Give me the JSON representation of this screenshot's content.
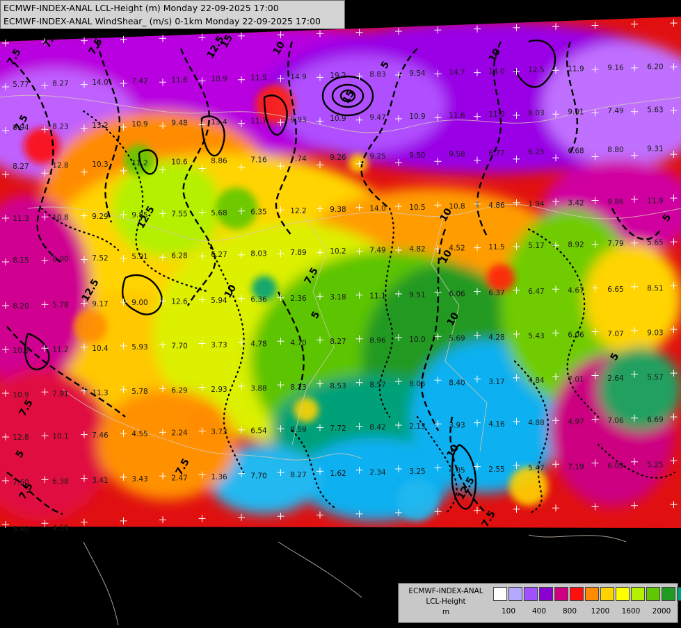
{
  "header": {
    "line1": "ECMWF-INDEX-ANAL LCL-Height (m) Monday 22-09-2025 17:00",
    "line2": "ECMWF-INDEX-ANAL WindShear_ (m/s) 0-1km Monday 22-09-2025 17:00"
  },
  "legend": {
    "model": "ECMWF-INDEX-ANAL",
    "field": "LCL-Height",
    "unit": "m",
    "colors": [
      "#ffffff",
      "#b4a8ff",
      "#a050ff",
      "#8a00d2",
      "#cc0080",
      "#ff1010",
      "#ff8c00",
      "#ffd400",
      "#ffff00",
      "#b4f000",
      "#60c800",
      "#209a20",
      "#00a078",
      "#0aaaf0"
    ],
    "ticks": [
      "100",
      "400",
      "800",
      "1200",
      "1600",
      "2000"
    ]
  },
  "contour_labels": [
    "7.5",
    "10",
    "12.5",
    "15",
    "5"
  ],
  "station_values": [
    "5.77",
    "8.27",
    "14.0",
    "7.42",
    "11.6",
    "10.9",
    "11.5",
    "14.9",
    "19.2",
    "8.83",
    "9.54",
    "14.7",
    "14.0",
    "12.5",
    "11.9",
    "9.16",
    "6.20",
    "8.94",
    "8.23",
    "13.2",
    "10.9",
    "9.48",
    "13.4",
    "11.7",
    "9.93",
    "10.9",
    "9.47",
    "10.9",
    "11.6",
    "11.0",
    "8.03",
    "9.01",
    "7.49",
    "5.63",
    "8.27",
    "12.8",
    "10.3",
    "11.2",
    "10.6",
    "8.86",
    "7.16",
    "7.74",
    "9.26",
    "9.25",
    "9.50",
    "9.58",
    "6.77",
    "6.25",
    "6.68",
    "8.80",
    "9.31",
    "11.3",
    "10.8",
    "9.29",
    "9.85",
    "7.55",
    "5.68",
    "6.35",
    "12.2",
    "9.38",
    "14.0",
    "10.5",
    "10.8",
    "4.86",
    "1.94",
    "3.42",
    "9.86",
    "11.9",
    "8.15",
    "8.00",
    "7.52",
    "5.91",
    "6.28",
    "6.27",
    "8.03",
    "7.89",
    "10.2",
    "7.49",
    "4.82",
    "4.52",
    "11.5",
    "5.17",
    "8.92",
    "7.79",
    "5.65",
    "8.20",
    "5.78",
    "9.17",
    "9.00",
    "12.6",
    "5.94",
    "6.36",
    "2.36",
    "3.18",
    "11.1",
    "9.51",
    "6.06",
    "6.37",
    "6.47",
    "4.67",
    "6.65",
    "8.51",
    "10.3",
    "11.2",
    "10.4",
    "5.93",
    "7.70",
    "3.73",
    "4.78",
    "4.70",
    "8.27",
    "8.96",
    "10.0",
    "5.69",
    "4.28",
    "5.43",
    "6.06",
    "7.07",
    "9.03",
    "10.9",
    "7.91",
    "11.3",
    "5.78",
    "6.29",
    "2.93",
    "3.88",
    "8.13",
    "8.53",
    "8.57",
    "8.05",
    "8.40",
    "3.17",
    "4.84",
    "7.01",
    "2.64",
    "5.57",
    "12.8",
    "10.1",
    "7.46",
    "4.55",
    "2.24",
    "3.73",
    "6.54",
    "8.59",
    "7.72",
    "8.42",
    "2.13",
    "3.93",
    "4.16",
    "4.88",
    "4.97",
    "7.06",
    "6.69",
    "7.60",
    "6.38",
    "3.41",
    "3.43",
    "2.47",
    "1.36",
    "7.70",
    "8.27",
    "1.62",
    "2.34",
    "3.25",
    "4.05",
    "2.55",
    "5.47",
    "7.19",
    "6.09",
    "5.25",
    "5.40",
    "4.59"
  ]
}
